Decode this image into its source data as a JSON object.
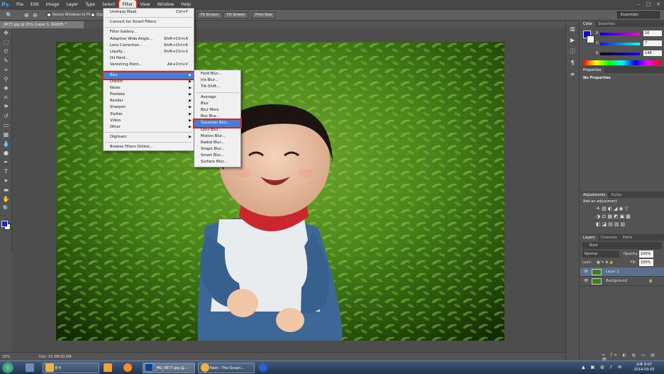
{
  "app": {
    "logo": "Ps"
  },
  "menubar": [
    "File",
    "Edit",
    "Image",
    "Layer",
    "Type",
    "Select",
    "Filter",
    "View",
    "Window",
    "Help"
  ],
  "window_controls": [
    "–",
    "□",
    "✕"
  ],
  "options": {
    "resize_label": "Resize Windows to Fit",
    "zoom_label": "Zoo",
    "buttons": [
      "Fit Screen",
      "Fill Screen",
      "Print Size"
    ],
    "workspace": "Essentials"
  },
  "doc_tab": "_9677.jpg @ 25% (Layer 1, RGB/8) *",
  "status": {
    "zoom": "25%",
    "doc": "Doc: 15.3M/30.6M"
  },
  "filter_menu": {
    "items": [
      {
        "label": "Unsharp Mask",
        "shortcut": "Ctrl+F"
      },
      {
        "sep": true
      },
      {
        "label": "Convert for Smart Filters"
      },
      {
        "sep": true
      },
      {
        "label": "Filter Gallery..."
      },
      {
        "label": "Adaptive Wide Angle...",
        "shortcut": "Shift+Ctrl+A"
      },
      {
        "label": "Lens Correction...",
        "shortcut": "Shift+Ctrl+R"
      },
      {
        "label": "Liquify...",
        "shortcut": "Shift+Ctrl+X"
      },
      {
        "label": "Oil Paint..."
      },
      {
        "label": "Vanishing Point...",
        "shortcut": "Alt+Ctrl+V"
      },
      {
        "sep": true
      },
      {
        "label": "Blur",
        "submenu": true,
        "highlighted": true
      },
      {
        "label": "Distort",
        "submenu": true
      },
      {
        "label": "Noise",
        "submenu": true
      },
      {
        "label": "Pixelate",
        "submenu": true
      },
      {
        "label": "Render",
        "submenu": true
      },
      {
        "label": "Sharpen",
        "submenu": true
      },
      {
        "label": "Stylize",
        "submenu": true
      },
      {
        "label": "Video",
        "submenu": true
      },
      {
        "label": "Other",
        "submenu": true
      },
      {
        "sep": true
      },
      {
        "label": "Digimarc",
        "submenu": true
      },
      {
        "sep": true
      },
      {
        "label": "Browse Filters Online..."
      }
    ]
  },
  "blur_menu": {
    "items": [
      {
        "label": "Field Blur..."
      },
      {
        "label": "Iris Blur..."
      },
      {
        "label": "Tilt-Shift..."
      },
      {
        "sep": true
      },
      {
        "label": "Average"
      },
      {
        "label": "Blur"
      },
      {
        "label": "Blur More"
      },
      {
        "label": "Box Blur..."
      },
      {
        "label": "Gaussian Blur...",
        "highlighted": true
      },
      {
        "label": "Lens Blur..."
      },
      {
        "label": "Motion Blur..."
      },
      {
        "label": "Radial Blur..."
      },
      {
        "label": "Shape Blur..."
      },
      {
        "label": "Smart Blur..."
      },
      {
        "label": "Surface Blur..."
      }
    ]
  },
  "color_panel": {
    "tabs": [
      "Color",
      "Swatches"
    ],
    "channels": [
      {
        "label": "R",
        "value": "16",
        "gradient": "#0000e0,#ff00e0"
      },
      {
        "label": "G",
        "value": "7",
        "gradient": "#1010e0,#10ffe0"
      },
      {
        "label": "B",
        "value": "148",
        "gradient": "#100700,#1007ff"
      }
    ],
    "foreground": "#1007d4"
  },
  "properties_panel": {
    "tab": "Properties",
    "text": "No Properties"
  },
  "adjustments_panel": {
    "tabs": [
      "Adjustments",
      "Styles"
    ],
    "title": "Add an adjustment"
  },
  "layers_panel": {
    "tabs": [
      "Layers",
      "Channels",
      "Paths"
    ],
    "kind": "Kind",
    "blend": "Normal",
    "opacity_label": "Opacity:",
    "opacity": "100%",
    "lock_label": "Lock:",
    "fill_label": "Fill:",
    "fill": "100%",
    "layers": [
      {
        "name": "Layer 1",
        "selected": true
      },
      {
        "name": "Background",
        "selected": false
      }
    ]
  },
  "taskbar": {
    "tasks": [
      {
        "label": "문서"
      },
      {
        "label": "_MG_9677.jpg @..."
      },
      {
        "label": "Nest - The Ocean..."
      }
    ],
    "time": "오후 9:07",
    "date": "2014-03-05"
  }
}
